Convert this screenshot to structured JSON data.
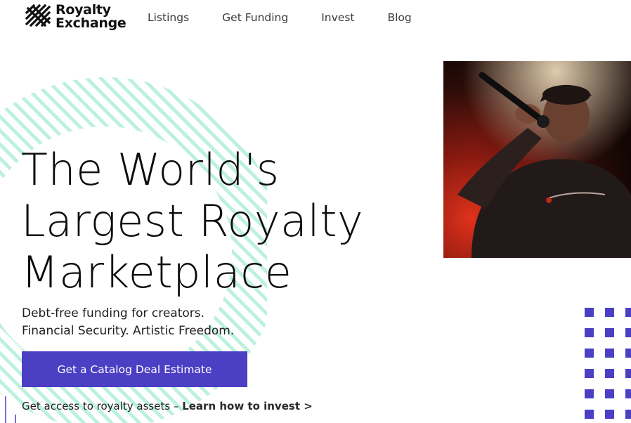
{
  "brand": {
    "name_line1": "Royalty",
    "name_line2": "Exchange",
    "logo_icon": "crosshatch-stripes-logo"
  },
  "nav": {
    "items": [
      {
        "label": "Listings"
      },
      {
        "label": "Get Funding"
      },
      {
        "label": "Invest"
      },
      {
        "label": "Blog"
      }
    ]
  },
  "hero": {
    "headline_line1": "The World's",
    "headline_line2": "Largest Royalty",
    "headline_line3": "Marketplace",
    "sub_line1": "Debt-free funding for creators.",
    "sub_line2": "Financial Security. Artistic Freedom.",
    "cta_label": "Get a Catalog Deal Estimate",
    "invest_text": "Get access to royalty assets – ",
    "invest_link": "Learn how to invest >"
  },
  "photo": {
    "subject": "performer-singing-into-microphone"
  },
  "colors": {
    "accent": "#4b3fc4",
    "stripes": "#bdf1dc",
    "dots": "#4b3fc4"
  }
}
